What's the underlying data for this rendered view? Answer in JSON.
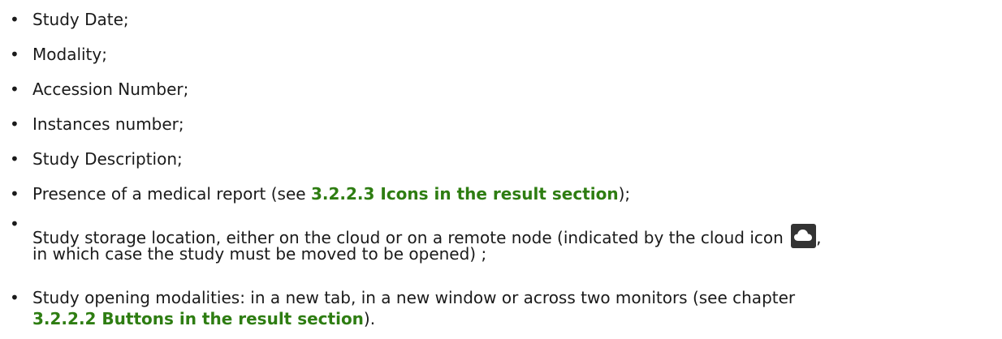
{
  "list": {
    "items": [
      {
        "text": "Study Date;"
      },
      {
        "text": "Modality;"
      },
      {
        "text": "Accession Number;"
      },
      {
        "text": "Instances number;"
      },
      {
        "text": "Study Description;"
      },
      {
        "before": "Presence of a medical report (see ",
        "link": "3.2.2.3 Icons in the result section",
        "after": ");"
      },
      {
        "line1_before": "Study storage location, either on the cloud or on a remote node (indicated by the cloud icon",
        "line1_after": ",",
        "line2": "in which case the study must be moved to be opened) ;",
        "icon": "cloud-icon"
      },
      {
        "line1": "Study opening modalities: in a new tab, in a new window or across two monitors (see chapter",
        "link": "3.2.2.2 Buttons in the result section",
        "after": ")."
      }
    ]
  },
  "colors": {
    "link": "#2e7d12",
    "text": "#1a1a1a",
    "icon_bg": "#333333"
  }
}
